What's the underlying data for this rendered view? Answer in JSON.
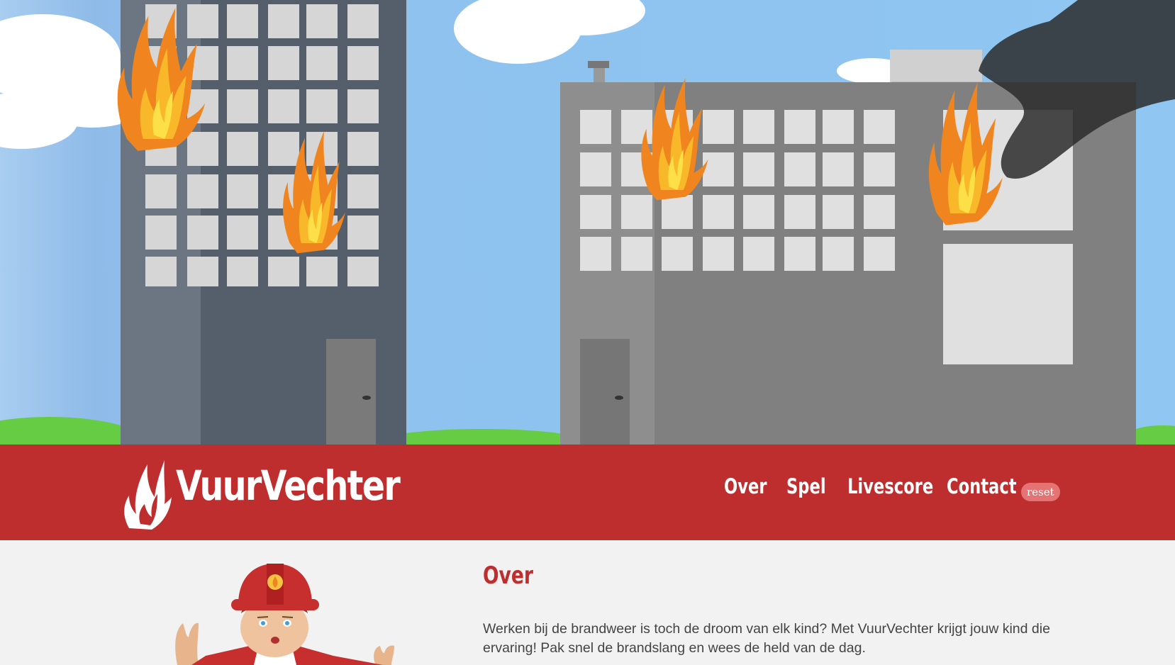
{
  "brand": {
    "name": "VuurVechter"
  },
  "nav": {
    "items": [
      {
        "label": "Over"
      },
      {
        "label": "Spel"
      },
      {
        "label": "Livescore"
      },
      {
        "label": "Contact"
      }
    ],
    "reset_label": "reset"
  },
  "about": {
    "title": "Over",
    "text": "Werken bij de brandweer is toch de droom van elk kind? Met VuurVechter krijgt jouw kind die ervaring! Pak snel de brandslang en wees de held van de dag."
  },
  "colors": {
    "brand_red": "#bf2e2e",
    "sky": "#8fc2ee",
    "grass": "#66cc44",
    "badge": "#e57373",
    "page_bg": "#f2f2f2"
  },
  "icons": [
    "flame-logo-icon",
    "fire-icon",
    "smoke-icon",
    "fireman-illustration"
  ]
}
